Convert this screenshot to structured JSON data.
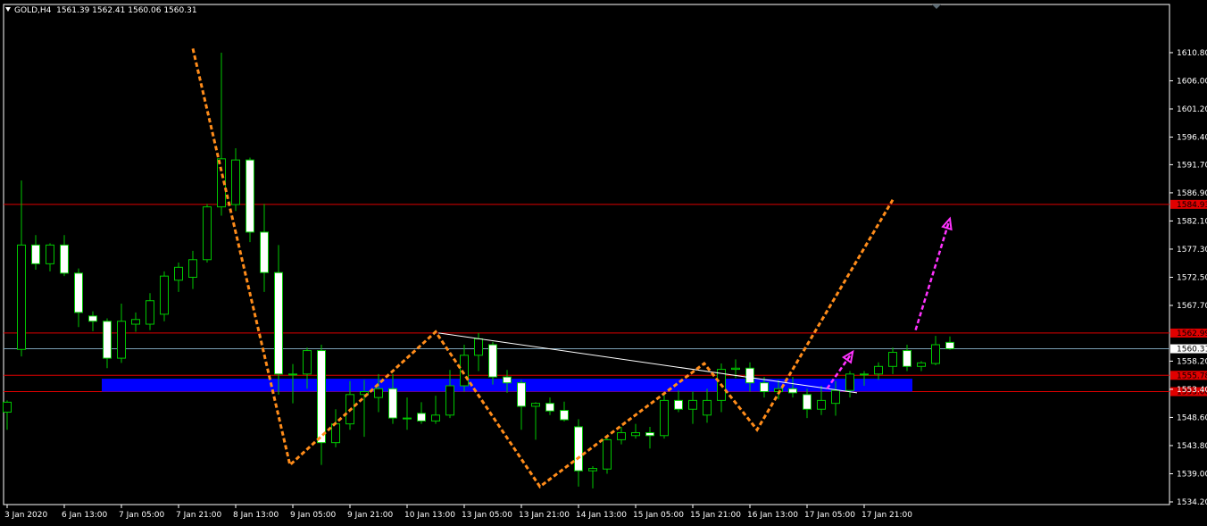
{
  "header": {
    "symbol": "GOLD,H4",
    "ohlc": "1561.39 1562.41 1560.06 1560.31"
  },
  "colors": {
    "background": "#000000",
    "frame": "#ffffff",
    "bull_body": "#000000",
    "bear_body": "#ffffff",
    "wick": "#00c800",
    "level_line": "#e00000",
    "level_badge": "#e00000",
    "price_line": "#7b9fb5",
    "zone": "#0000ff",
    "zigzag": "#ff8c1a",
    "projection": "#ff33ff",
    "trendline": "#ffffff"
  },
  "chart_data": {
    "type": "candlestick",
    "ylim": [
      1534.2,
      1614.6
    ],
    "y_ticks": [
      "1610.80",
      "1606.00",
      "1601.20",
      "1596.40",
      "1591.70",
      "1586.90",
      "1582.10",
      "1577.30",
      "1572.50",
      "1567.70",
      "1558.20",
      "1553.40",
      "1548.60",
      "1543.80",
      "1539.00",
      "1534.20"
    ],
    "x_ticks": [
      "3 Jan 2020",
      "6 Jan 13:00",
      "7 Jan 05:00",
      "7 Jan 21:00",
      "8 Jan 13:00",
      "9 Jan 05:00",
      "9 Jan 21:00",
      "10 Jan 13:00",
      "13 Jan 05:00",
      "13 Jan 21:00",
      "14 Jan 13:00",
      "15 Jan 05:00",
      "15 Jan 21:00",
      "16 Jan 13:00",
      "17 Jan 05:00",
      "17 Jan 21:00"
    ],
    "current_price": {
      "label": "1560.31",
      "value": 1560.31
    },
    "levels": [
      {
        "label": "1584.93",
        "value": 1584.93
      },
      {
        "label": "1562.99",
        "value": 1562.99
      },
      {
        "label": "1555.78",
        "value": 1555.78
      },
      {
        "label": "1553.00",
        "value": 1553.0
      }
    ],
    "zone": {
      "from": 1553.0,
      "to": 1555.2,
      "start_bar": 7,
      "end_bar": 63
    },
    "candles": [
      {
        "o": 1549.5,
        "h": 1551.5,
        "l": 1546.5,
        "c": 1551.2
      },
      {
        "o": 1560.2,
        "h": 1589.0,
        "l": 1559.0,
        "c": 1578.0
      },
      {
        "o": 1578.0,
        "h": 1579.7,
        "l": 1573.8,
        "c": 1574.8
      },
      {
        "o": 1574.8,
        "h": 1578.3,
        "l": 1573.5,
        "c": 1578.0
      },
      {
        "o": 1578.0,
        "h": 1579.7,
        "l": 1572.7,
        "c": 1573.2
      },
      {
        "o": 1573.2,
        "h": 1574.0,
        "l": 1564.0,
        "c": 1566.5
      },
      {
        "o": 1565.9,
        "h": 1566.7,
        "l": 1563.3,
        "c": 1565.0
      },
      {
        "o": 1565.0,
        "h": 1565.5,
        "l": 1557.0,
        "c": 1558.7
      },
      {
        "o": 1558.7,
        "h": 1568.0,
        "l": 1557.9,
        "c": 1565.0
      },
      {
        "o": 1564.5,
        "h": 1566.5,
        "l": 1563.2,
        "c": 1565.3
      },
      {
        "o": 1564.5,
        "h": 1569.8,
        "l": 1563.5,
        "c": 1568.5
      },
      {
        "o": 1566.2,
        "h": 1573.5,
        "l": 1565.0,
        "c": 1572.7
      },
      {
        "o": 1572.0,
        "h": 1575.0,
        "l": 1570.0,
        "c": 1574.2
      },
      {
        "o": 1572.5,
        "h": 1577.0,
        "l": 1570.5,
        "c": 1575.5
      },
      {
        "o": 1575.5,
        "h": 1585.0,
        "l": 1575.0,
        "c": 1584.5
      },
      {
        "o": 1584.5,
        "h": 1610.8,
        "l": 1583.0,
        "c": 1592.7
      },
      {
        "o": 1584.9,
        "h": 1594.5,
        "l": 1583.8,
        "c": 1592.5
      },
      {
        "o": 1592.5,
        "h": 1592.9,
        "l": 1578.5,
        "c": 1580.2
      },
      {
        "o": 1580.2,
        "h": 1585.0,
        "l": 1570.0,
        "c": 1573.3
      },
      {
        "o": 1573.3,
        "h": 1578.0,
        "l": 1552.5,
        "c": 1556.0
      },
      {
        "o": 1556.0,
        "h": 1557.7,
        "l": 1551.0,
        "c": 1556.0
      },
      {
        "o": 1556.0,
        "h": 1560.5,
        "l": 1553.5,
        "c": 1560.0
      },
      {
        "o": 1560.0,
        "h": 1561.0,
        "l": 1540.5,
        "c": 1544.3
      },
      {
        "o": 1544.3,
        "h": 1550.0,
        "l": 1543.5,
        "c": 1547.5
      },
      {
        "o": 1547.5,
        "h": 1554.8,
        "l": 1546.5,
        "c": 1552.5
      },
      {
        "o": 1552.5,
        "h": 1555.0,
        "l": 1545.3,
        "c": 1553.0
      },
      {
        "o": 1552.0,
        "h": 1556.0,
        "l": 1549.5,
        "c": 1553.5
      },
      {
        "o": 1553.5,
        "h": 1556.0,
        "l": 1547.5,
        "c": 1548.5
      },
      {
        "o": 1548.5,
        "h": 1552.0,
        "l": 1546.5,
        "c": 1548.5
      },
      {
        "o": 1549.3,
        "h": 1551.2,
        "l": 1547.5,
        "c": 1548.0
      },
      {
        "o": 1548.0,
        "h": 1552.3,
        "l": 1547.5,
        "c": 1549.0
      },
      {
        "o": 1549.0,
        "h": 1556.7,
        "l": 1548.5,
        "c": 1554.0
      },
      {
        "o": 1554.0,
        "h": 1561.0,
        "l": 1553.0,
        "c": 1559.2
      },
      {
        "o": 1559.2,
        "h": 1563.0,
        "l": 1556.5,
        "c": 1562.0
      },
      {
        "o": 1561.0,
        "h": 1561.5,
        "l": 1554.2,
        "c": 1555.5
      },
      {
        "o": 1555.5,
        "h": 1556.7,
        "l": 1552.8,
        "c": 1554.5
      },
      {
        "o": 1554.5,
        "h": 1555.0,
        "l": 1546.5,
        "c": 1550.5
      },
      {
        "o": 1550.5,
        "h": 1551.2,
        "l": 1544.8,
        "c": 1551.0
      },
      {
        "o": 1551.0,
        "h": 1552.0,
        "l": 1549.0,
        "c": 1549.7
      },
      {
        "o": 1549.8,
        "h": 1551.3,
        "l": 1547.9,
        "c": 1548.2
      },
      {
        "o": 1547.0,
        "h": 1548.3,
        "l": 1536.8,
        "c": 1539.5
      },
      {
        "o": 1539.5,
        "h": 1540.3,
        "l": 1536.5,
        "c": 1539.9
      },
      {
        "o": 1539.8,
        "h": 1545.5,
        "l": 1539.0,
        "c": 1544.8
      },
      {
        "o": 1544.8,
        "h": 1547.0,
        "l": 1544.0,
        "c": 1546.0
      },
      {
        "o": 1545.5,
        "h": 1547.5,
        "l": 1545.0,
        "c": 1546.0
      },
      {
        "o": 1546.0,
        "h": 1547.0,
        "l": 1543.3,
        "c": 1545.5
      },
      {
        "o": 1545.5,
        "h": 1552.7,
        "l": 1545.0,
        "c": 1551.5
      },
      {
        "o": 1551.5,
        "h": 1553.2,
        "l": 1549.5,
        "c": 1550.0
      },
      {
        "o": 1550.0,
        "h": 1553.0,
        "l": 1547.5,
        "c": 1551.5
      },
      {
        "o": 1549.0,
        "h": 1553.5,
        "l": 1547.7,
        "c": 1551.5
      },
      {
        "o": 1551.5,
        "h": 1557.8,
        "l": 1549.5,
        "c": 1556.8
      },
      {
        "o": 1556.8,
        "h": 1558.5,
        "l": 1555.3,
        "c": 1557.0
      },
      {
        "o": 1557.0,
        "h": 1558.0,
        "l": 1553.0,
        "c": 1554.5
      },
      {
        "o": 1554.5,
        "h": 1555.5,
        "l": 1552.0,
        "c": 1553.0
      },
      {
        "o": 1553.0,
        "h": 1555.0,
        "l": 1551.7,
        "c": 1553.5
      },
      {
        "o": 1553.5,
        "h": 1555.5,
        "l": 1552.0,
        "c": 1552.8
      },
      {
        "o": 1552.5,
        "h": 1553.5,
        "l": 1548.5,
        "c": 1550.0
      },
      {
        "o": 1550.0,
        "h": 1554.0,
        "l": 1549.0,
        "c": 1551.5
      },
      {
        "o": 1551.0,
        "h": 1554.8,
        "l": 1548.9,
        "c": 1553.2
      },
      {
        "o": 1553.2,
        "h": 1556.5,
        "l": 1552.0,
        "c": 1556.0
      },
      {
        "o": 1556.0,
        "h": 1556.5,
        "l": 1554.0,
        "c": 1556.0
      },
      {
        "o": 1556.0,
        "h": 1558.0,
        "l": 1555.0,
        "c": 1557.3
      },
      {
        "o": 1557.3,
        "h": 1560.5,
        "l": 1556.0,
        "c": 1559.7
      },
      {
        "o": 1560.0,
        "h": 1561.0,
        "l": 1556.5,
        "c": 1557.3
      },
      {
        "o": 1557.3,
        "h": 1558.2,
        "l": 1556.5,
        "c": 1557.9
      },
      {
        "o": 1557.8,
        "h": 1562.5,
        "l": 1557.5,
        "c": 1561.0
      },
      {
        "o": 1561.4,
        "h": 1562.4,
        "l": 1560.1,
        "c": 1560.3
      }
    ],
    "zigzag": [
      {
        "bar": 13,
        "value": 1611.5
      },
      {
        "bar": 19.8,
        "value": 1540.5
      },
      {
        "bar": 30.0,
        "value": 1563.2
      },
      {
        "bar": 37.3,
        "value": 1536.8
      },
      {
        "bar": 48.8,
        "value": 1557.8
      },
      {
        "bar": 52.5,
        "value": 1546.5
      },
      {
        "bar": 62.0,
        "value": 1585.7
      }
    ],
    "trendline": [
      {
        "bar": 30.2,
        "value": 1563.0
      },
      {
        "bar": 59.5,
        "value": 1552.8
      }
    ],
    "projections": [
      {
        "from_bar": 57.4,
        "from": 1553.5,
        "to_bar": 59.2,
        "to": 1559.8
      },
      {
        "from_bar": 63.6,
        "from": 1563.5,
        "to_bar": 66.0,
        "to": 1582.5
      }
    ]
  }
}
